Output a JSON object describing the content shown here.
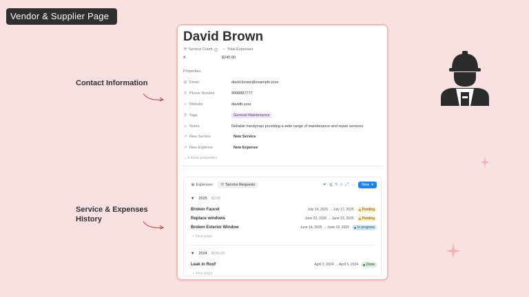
{
  "header": {
    "badge": "Vendor & Supplier Page"
  },
  "side_labels": {
    "contact": "Contact Information",
    "history_line1": "Service & Expenses",
    "history_line2": "History"
  },
  "page": {
    "title": "David Brown",
    "stats": {
      "service_count_label": "Service Count",
      "service_count_value": "4",
      "total_expenses_label": "Total Expenses",
      "total_expenses_value": "$240.00"
    },
    "properties_heading": "Properties",
    "properties": [
      {
        "key": "Email",
        "icon": "at-icon",
        "value": "david.brown@example.zzzz"
      },
      {
        "key": "Phone Number",
        "icon": "phone-icon",
        "value": "9998887777"
      },
      {
        "key": "Website",
        "icon": "link-icon",
        "value": "davidb.zzzz"
      },
      {
        "key": "Tags",
        "icon": "list-icon",
        "value": "General Maintenance"
      },
      {
        "key": "Notes",
        "icon": "text-icon",
        "value": "Reliable handyman providing a wide range of maintenance and repair services"
      },
      {
        "key": "New Service",
        "icon": "relation-icon",
        "value": "New Service"
      },
      {
        "key": "New Expense",
        "icon": "relation-icon",
        "value": "New Expense"
      }
    ],
    "more_properties": "3 more properties"
  },
  "database": {
    "tabs": [
      "Expenses",
      "Service Requests"
    ],
    "active_tab": 1,
    "new_button": "New",
    "groups": [
      {
        "year": "2025",
        "amount": "$0.00",
        "rows": [
          {
            "name": "Broken Faucet",
            "dates": "July 14, 2025 → July 17, 2025",
            "status": "Pending"
          },
          {
            "name": "Replace windows",
            "dates": "June 23, 2025 → June 23, 2025",
            "status": "Pending"
          },
          {
            "name": "Broken Exterior Window",
            "dates": "June 14, 2025 → June 18, 2025",
            "status": "In progress"
          }
        ],
        "new_page": "New page"
      },
      {
        "year": "2024",
        "amount": "$240.00",
        "rows": [
          {
            "name": "Leak in Roof",
            "dates": "April 3, 2024 → April 5, 2024",
            "status": "Done"
          }
        ],
        "new_page": "New page"
      }
    ]
  },
  "colors": {
    "background": "#f9e1e1",
    "pending": "#fdecc8",
    "in_progress": "#d3e5ef",
    "done": "#dbeddb",
    "accent": "#2383e2",
    "arrow": "#c0392b"
  }
}
